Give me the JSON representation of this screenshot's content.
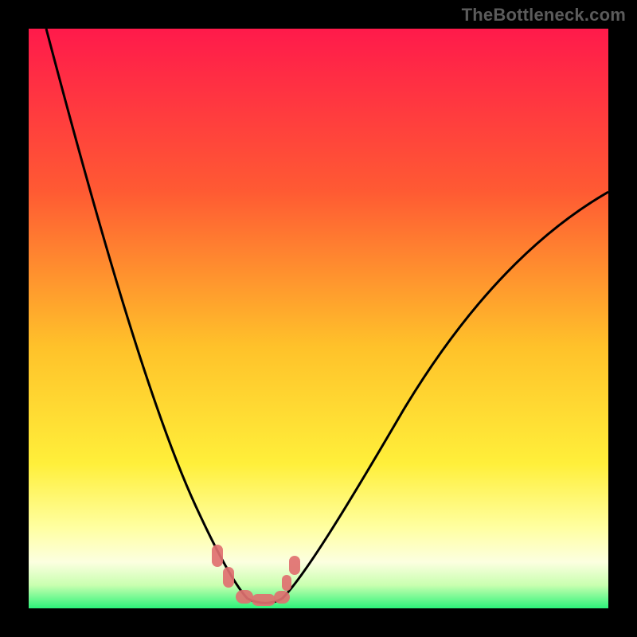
{
  "watermark": "TheBottleneck.com",
  "colors": {
    "gradient_top": "#ff1a4b",
    "gradient_mid1": "#ff6a2a",
    "gradient_mid2": "#ffd22a",
    "gradient_mid3": "#ffff66",
    "gradient_mid4": "#fbffd0",
    "gradient_bottom": "#2cf37a",
    "curve": "#000000",
    "marker": "#e07070",
    "frame": "#000000"
  },
  "chart_data": {
    "type": "line",
    "title": "",
    "xlabel": "",
    "ylabel": "",
    "xlim": [
      0,
      100
    ],
    "ylim": [
      0,
      100
    ],
    "grid": false,
    "legend": false,
    "series": [
      {
        "name": "left-branch",
        "x": [
          3,
          8,
          14,
          20,
          25,
          29,
          32,
          35,
          37
        ],
        "y": [
          100,
          82,
          62,
          42,
          27,
          16,
          9,
          4,
          1
        ]
      },
      {
        "name": "right-branch",
        "x": [
          43,
          46,
          50,
          56,
          63,
          72,
          82,
          92,
          100
        ],
        "y": [
          1,
          4,
          9,
          17,
          27,
          40,
          53,
          64,
          72
        ]
      },
      {
        "name": "valley-floor",
        "x": [
          37,
          40,
          43
        ],
        "y": [
          1,
          0.5,
          1
        ]
      }
    ],
    "markers": [
      {
        "name": "left-node-upper",
        "x": 33,
        "y": 8
      },
      {
        "name": "left-node-lower",
        "x": 35,
        "y": 4
      },
      {
        "name": "right-node-upper",
        "x": 46,
        "y": 6
      },
      {
        "name": "right-node-lower",
        "x": 44.5,
        "y": 3
      },
      {
        "name": "floor-left",
        "x": 37,
        "y": 1.2
      },
      {
        "name": "floor-mid",
        "x": 40,
        "y": 0.8
      },
      {
        "name": "floor-right",
        "x": 43,
        "y": 1.2
      }
    ]
  }
}
